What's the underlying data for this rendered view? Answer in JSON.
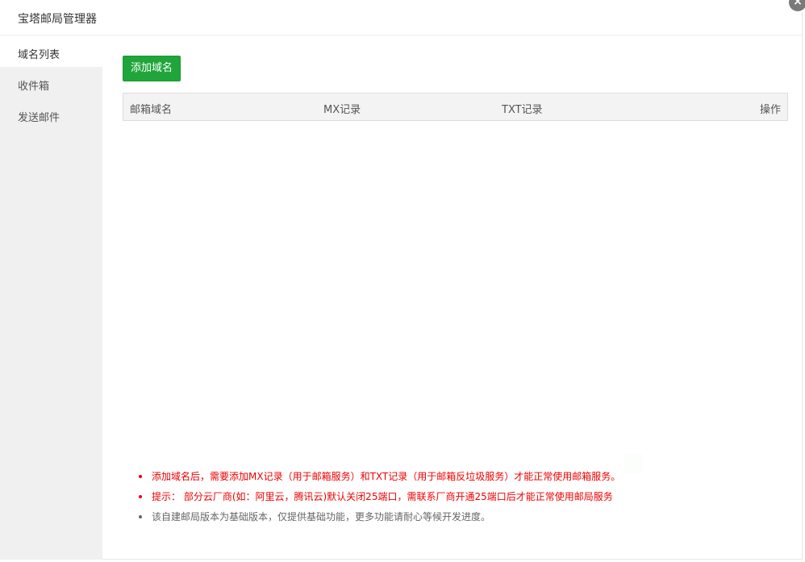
{
  "modal": {
    "title": "宝塔邮局管理器",
    "close_symbol": "×"
  },
  "sidebar": {
    "items": [
      {
        "label": "域名列表",
        "active": true
      },
      {
        "label": "收件箱",
        "active": false
      },
      {
        "label": "发送邮件",
        "active": false
      }
    ]
  },
  "toolbar": {
    "add_domain_label": "添加域名"
  },
  "table": {
    "columns": [
      "邮箱域名",
      "MX记录",
      "TXT记录",
      "操作"
    ]
  },
  "notes": [
    {
      "text": "添加域名后，需要添加MX记录（用于邮箱服务）和TXT记录（用于邮箱反垃圾服务）才能正常使用邮箱服务。",
      "style": "red"
    },
    {
      "text": "提示： 部分云厂商(如：阿里云，腾讯云)默认关闭25端口，需联系厂商开通25端口后才能正常使用邮局服务",
      "style": "red"
    },
    {
      "text": "该自建邮局版本为基础版本，仅提供基础功能，更多功能请耐心等候开发进度。",
      "style": "gray"
    }
  ],
  "colors": {
    "accent": "#20a53a",
    "warning_text": "#ee0000",
    "info_text": "#666666"
  },
  "icons": {
    "close": "close-icon"
  }
}
